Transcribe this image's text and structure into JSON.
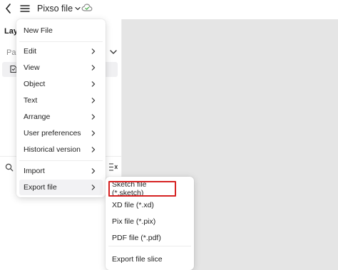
{
  "topbar": {
    "file_name": "Pixso file",
    "icons": {
      "back": "back-arrow-icon",
      "menu": "hamburger-menu-icon",
      "cloud": "cloud-sync-icon"
    }
  },
  "left_panel": {
    "tab_label": "Layers",
    "pages_label": "Pages"
  },
  "main_menu": {
    "items": [
      {
        "label": "New File",
        "has_submenu": false
      },
      {
        "label": "Edit",
        "has_submenu": true
      },
      {
        "label": "View",
        "has_submenu": true
      },
      {
        "label": "Object",
        "has_submenu": true
      },
      {
        "label": "Text",
        "has_submenu": true
      },
      {
        "label": "Arrange",
        "has_submenu": true
      },
      {
        "label": "User preferences",
        "has_submenu": true
      },
      {
        "label": "Historical version",
        "has_submenu": true
      },
      {
        "label": "Import",
        "has_submenu": true
      },
      {
        "label": "Export file",
        "has_submenu": true,
        "active": true
      }
    ]
  },
  "export_submenu": {
    "items": [
      {
        "label": "Sketch file (*.sketch)",
        "highlighted": true
      },
      {
        "label": "XD file (*.xd)"
      },
      {
        "label": "Pix file (*.pix)"
      },
      {
        "label": "PDF file (*.pdf)"
      },
      {
        "label": "Export file slice"
      }
    ]
  },
  "colors": {
    "canvas": "#e5e5e5",
    "highlight_outline": "#d62222",
    "hover_bg": "#f2f2f4",
    "cloud_icon": "#4caf50"
  }
}
